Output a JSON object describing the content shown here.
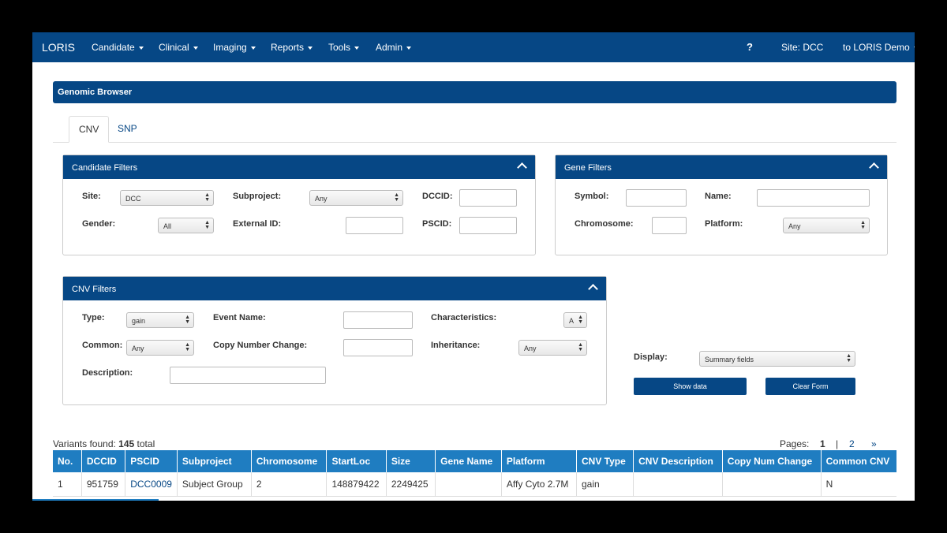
{
  "navbar": {
    "brand": "LORIS",
    "menus": [
      "Candidate",
      "Clinical",
      "Imaging",
      "Reports",
      "Tools",
      "Admin"
    ],
    "help": "?",
    "site": "Site: DCC",
    "user": "to LORIS Demo"
  },
  "page": {
    "title": "Genomic Browser"
  },
  "tabs": [
    {
      "label": "CNV",
      "active": true
    },
    {
      "label": "SNP",
      "active": false
    }
  ],
  "candidate_filters": {
    "title": "Candidate Filters",
    "site_label": "Site:",
    "site_value": "DCC",
    "subproject_label": "Subproject:",
    "subproject_value": "Any",
    "dccid_label": "DCCID:",
    "gender_label": "Gender:",
    "gender_value": "All",
    "external_id_label": "External ID:",
    "pscid_label": "PSCID:"
  },
  "gene_filters": {
    "title": "Gene Filters",
    "symbol_label": "Symbol:",
    "name_label": "Name:",
    "chromosome_label": "Chromosome:",
    "platform_label": "Platform:",
    "platform_value": "Any"
  },
  "cnv_filters": {
    "title": "CNV Filters",
    "type_label": "Type:",
    "type_value": "gain",
    "event_name_label": "Event Name:",
    "characteristics_label": "Characteristics:",
    "characteristics_value": "A",
    "common_label": "Common:",
    "common_value": "Any",
    "copy_number_change_label": "Copy Number Change:",
    "inheritance_label": "Inheritance:",
    "inheritance_value": "Any",
    "description_label": "Description:"
  },
  "display": {
    "label": "Display:",
    "value": "Summary fields",
    "show_data": "Show data",
    "clear_form": "Clear Form"
  },
  "results": {
    "found_prefix": "Variants found:",
    "count": "145",
    "found_suffix": "total",
    "pages_label": "Pages:",
    "page_current": "1",
    "separator": "|",
    "page_next": "2",
    "next_arrow": "»",
    "columns": [
      "No.",
      "DCCID",
      "PSCID",
      "Subproject",
      "Chromosome",
      "StartLoc",
      "Size",
      "Gene Name",
      "Platform",
      "CNV Type",
      "CNV Description",
      "Copy Num Change",
      "Common CNV"
    ],
    "rows": [
      [
        "1",
        "951759",
        "DCC0009",
        "Subject Group",
        "2",
        "148879422",
        "2249425",
        "",
        "Affy Cyto 2.7M",
        "gain",
        "",
        "",
        "N"
      ]
    ]
  },
  "colors": {
    "navy": "#064785",
    "header_blue": "#1f7dc1"
  }
}
